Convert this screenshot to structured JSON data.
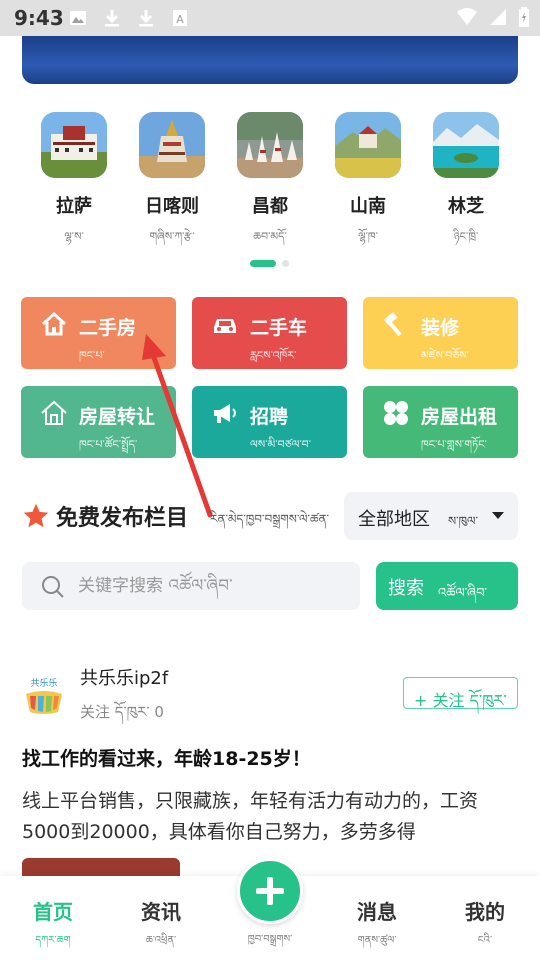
{
  "status_bar": {
    "time": "9:43"
  },
  "cities": [
    {
      "name": "拉萨",
      "sub": "ལྷ་ས་"
    },
    {
      "name": "日喀则",
      "sub": "གཞིས་ཀ་རྩེ་"
    },
    {
      "name": "昌都",
      "sub": "ཆབ་མདོ་"
    },
    {
      "name": "山南",
      "sub": "ལྷོ་ཁ་"
    },
    {
      "name": "林芝",
      "sub": "ཉིང་ཁྲི་"
    }
  ],
  "categories": [
    {
      "title": "二手房",
      "sub": "ཁང་པ་",
      "color": "#f0875e",
      "icon": "home-icon"
    },
    {
      "title": "二手车",
      "sub": "རླངས་འཁོར་",
      "color": "#e54c4c",
      "icon": "car-icon"
    },
    {
      "title": "装修",
      "sub": "མཛེས་བཅོས་",
      "color": "#fdd054",
      "icon": "hammer-icon"
    },
    {
      "title": "房屋转让",
      "sub": "ཁང་པ་ཚོང་སྤྲོད་",
      "color": "#52b78e",
      "icon": "house-outline-icon"
    },
    {
      "title": "招聘",
      "sub": "ལས་མི་བཙལ་བ་",
      "color": "#1ba99b",
      "icon": "megaphone-icon"
    },
    {
      "title": "房屋出租",
      "sub": "ཁང་པ་གླས་གཏོང་",
      "color": "#45b977",
      "icon": "clover-icon"
    }
  ],
  "section": {
    "title": "免费发布栏目",
    "sub": "རིན་མེད་ཁྱབ་བསྒྲགས་ལེ་ཚན་",
    "region_label": "全部地区",
    "region_sub": "ས་ཁུལ་"
  },
  "search": {
    "placeholder": "关键字搜索 འཚོལ་ཞིབ་",
    "button_label": "搜索",
    "button_sub": "འཚོལ་ཞིབ་"
  },
  "post": {
    "avatar_text": "共乐乐",
    "user": "共乐乐ip2f",
    "follow_count": "关注 དོ་ཁུར་ 0",
    "follow_button": "+ 关注 དོ་ཁུར་",
    "title": "找工作的看过来，年龄18-25岁！",
    "body": "线上平台销售，只限藏族，年轻有活力有动力的，工资5000到20000，具体看你自己努力，多劳多得"
  },
  "nav": {
    "home": "首页",
    "home_sub": "དཀར་ཆག",
    "news": "资讯",
    "news_sub": "ཆ་འཕྲིན་",
    "publish_sub": "ཁྱབ་བསྒྲགས་",
    "messages": "消息",
    "messages_sub": "གནས་ཚུལ་",
    "mine": "我的",
    "mine_sub": "ངའི་"
  },
  "colors": {
    "accent": "#26c28a",
    "arrow": "#e53935"
  }
}
